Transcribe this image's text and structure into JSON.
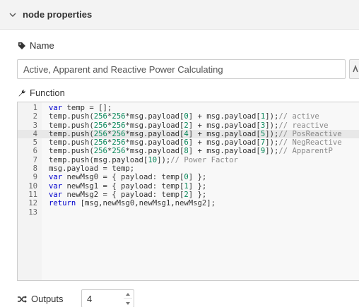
{
  "section": {
    "title": "node properties",
    "icon": "chevron-down-icon"
  },
  "name": {
    "label": "Name",
    "icon": "tag-icon",
    "value": "Active, Apparent and Reactive Power Calculating"
  },
  "function": {
    "label": "Function",
    "icon": "wrench-icon",
    "line_numbers": [
      "1",
      "2",
      "3",
      "4",
      "5",
      "6",
      "7",
      "8",
      "9",
      "10",
      "11",
      "12",
      "13"
    ],
    "active_line": 4,
    "code_lines": [
      "var temp = [];",
      "temp.push(256*256*msg.payload[0] + msg.payload[1]);// active",
      "temp.push(256*256*msg.payload[2] + msg.payload[3]);// reactive",
      "temp.push(256*256*msg.payload[4] + msg.payload[5]);// PosReactive",
      "temp.push(256*256*msg.payload[6] + msg.payload[7]);// NegReactive",
      "temp.push(256*256*msg.payload[8] + msg.payload[9]);// ApparentP",
      "temp.push(msg.payload[10]);// Power Factor",
      "msg.payload = temp;",
      "var newMsg0 = { payload: temp[0] };",
      "var newMsg1 = { payload: temp[1] };",
      "var newMsg2 = { payload: temp[2] };",
      "return [msg,newMsg0,newMsg1,newMsg2];",
      ""
    ]
  },
  "outputs": {
    "label": "Outputs",
    "icon": "shuffle-icon",
    "value": "4"
  },
  "colors": {
    "keyword": "#0000cc",
    "number": "#09885a",
    "comment": "#888888",
    "header_bg": "#f3f3f3"
  }
}
